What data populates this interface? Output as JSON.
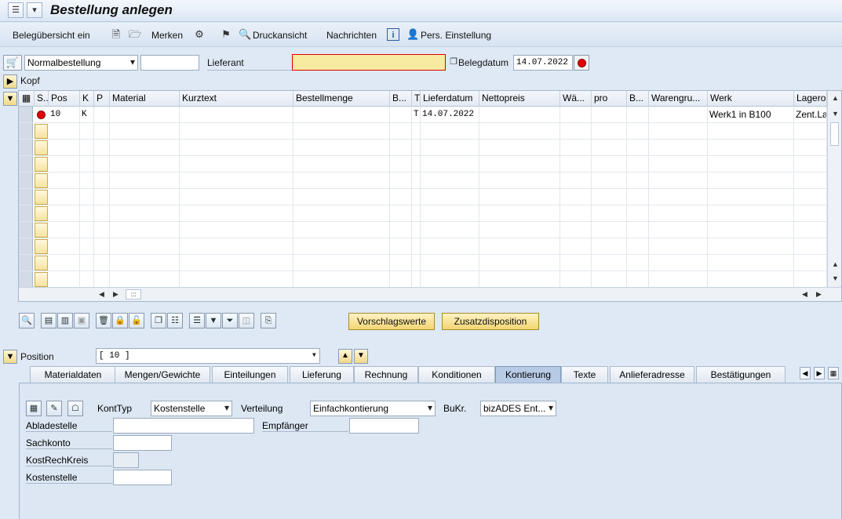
{
  "window": {
    "title": "Bestellung anlegen"
  },
  "toolbar": {
    "beleguebersicht": "Belegübersicht ein",
    "merken": "Merken",
    "druckansicht": "Druckansicht",
    "nachrichten": "Nachrichten",
    "pers_einstellung": "Pers. Einstellung"
  },
  "header": {
    "doc_type": "Normalbestellung",
    "doc_number": "",
    "lieferant_label": "Lieferant",
    "lieferant_value": "",
    "belegdatum_label": "Belegdatum",
    "belegdatum_value": "14.07.2022",
    "kopf_label": "Kopf"
  },
  "grid": {
    "columns": [
      "S..",
      "Pos",
      "K",
      "P",
      "Material",
      "Kurztext",
      "Bestellmenge",
      "B...",
      "T",
      "Lieferdatum",
      "Nettopreis",
      "Wä...",
      "pro",
      "B...",
      "Warengru...",
      "Werk",
      "Lagerort"
    ],
    "rows": [
      {
        "pos": "10",
        "k": "K",
        "t": "T",
        "lieferdatum": "14.07.2022",
        "werk": "Werk1 in B100",
        "lagerort": "Zent.La"
      }
    ],
    "empty_rows": 10
  },
  "buttons": {
    "vorschlagswerte": "Vorschlagswerte",
    "zusatzdisposition": "Zusatzdisposition"
  },
  "position": {
    "label": "Position",
    "value": "[ 10 ]"
  },
  "tabs": [
    {
      "label": "Materialdaten",
      "active": false
    },
    {
      "label": "Mengen/Gewichte",
      "active": false
    },
    {
      "label": "Einteilungen",
      "active": false
    },
    {
      "label": "Lieferung",
      "active": false
    },
    {
      "label": "Rechnung",
      "active": false
    },
    {
      "label": "Konditionen",
      "active": false
    },
    {
      "label": "Kontierung",
      "active": true
    },
    {
      "label": "Texte",
      "active": false
    },
    {
      "label": "Anlieferadresse",
      "active": false
    },
    {
      "label": "Bestätigungen",
      "active": false
    }
  ],
  "kontierung": {
    "konttyp_label": "KontTyp",
    "konttyp_value": "Kostenstelle",
    "verteilung_label": "Verteilung",
    "verteilung_value": "Einfachkontierung",
    "bukr_label": "BuKr.",
    "bukr_value": "bizADES Ent...",
    "abladestelle_label": "Abladestelle",
    "abladestelle_value": "",
    "empfaenger_label": "Empfänger",
    "empfaenger_value": "",
    "sachkonto_label": "Sachkonto",
    "sachkonto_value": "",
    "kostrechkreis_label": "KostRechKreis",
    "kostrechkreis_value": "",
    "kostenstelle_label": "Kostenstelle",
    "kostenstelle_value": ""
  },
  "colors": {
    "accent_yellow": "#f6eba0",
    "status_red": "#e00000",
    "panel_blue": "#dce7f3"
  }
}
